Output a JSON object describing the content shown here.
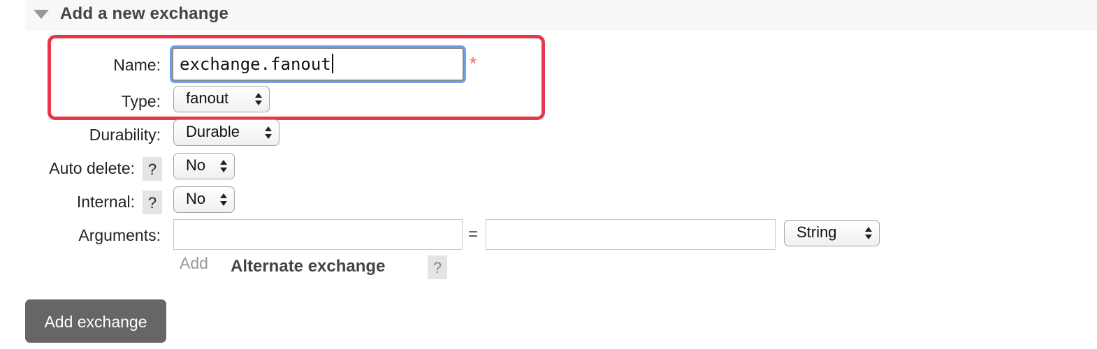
{
  "section": {
    "title": "Add a new exchange"
  },
  "form": {
    "name_label": "Name:",
    "name_value": "exchange.fanout",
    "required_mark": "*",
    "type_label": "Type:",
    "type_value": "fanout",
    "durability_label": "Durability:",
    "durability_value": "Durable",
    "auto_delete_label": "Auto delete:",
    "auto_delete_value": "No",
    "internal_label": "Internal:",
    "internal_value": "No",
    "arguments_label": "Arguments:",
    "arguments_key": "",
    "arguments_value": "",
    "equals_sign": "=",
    "arguments_type_value": "String",
    "help_mark": "?",
    "add_link": "Add",
    "alternate_exchange_label": "Alternate exchange"
  },
  "actions": {
    "submit_label": "Add exchange"
  },
  "colors": {
    "highlight_border": "#e8374a",
    "focus_ring": "#6ea0ea",
    "required_mark": "#ee6f6f",
    "submit_background": "#666666"
  }
}
